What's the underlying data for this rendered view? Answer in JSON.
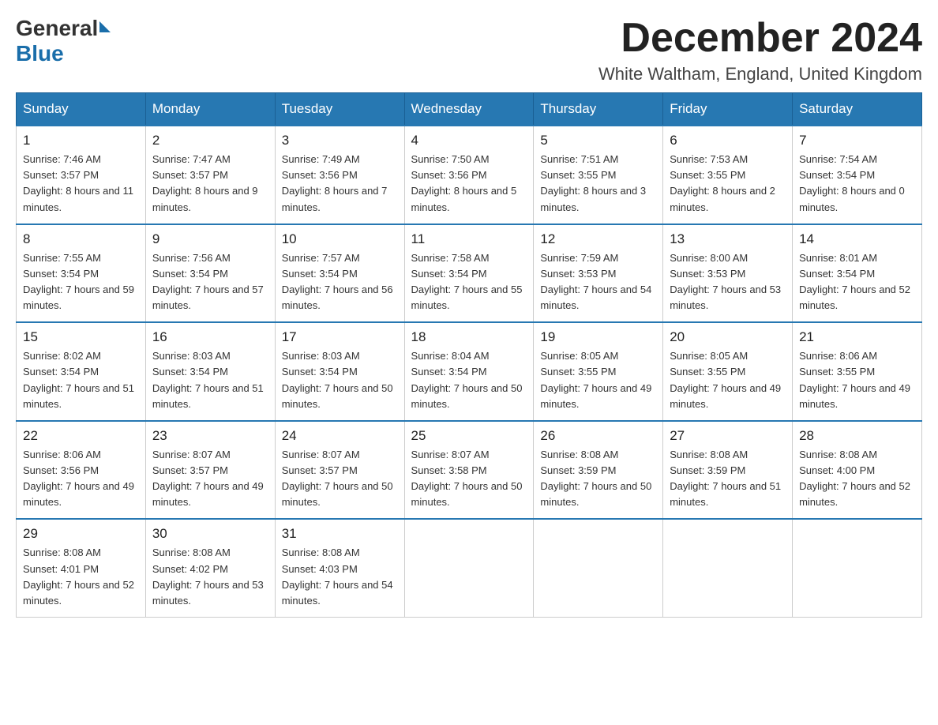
{
  "header": {
    "logo_general": "General",
    "logo_blue": "Blue",
    "month_title": "December 2024",
    "location": "White Waltham, England, United Kingdom"
  },
  "weekdays": [
    "Sunday",
    "Monday",
    "Tuesday",
    "Wednesday",
    "Thursday",
    "Friday",
    "Saturday"
  ],
  "weeks": [
    [
      {
        "day": "1",
        "sunrise": "7:46 AM",
        "sunset": "3:57 PM",
        "daylight": "8 hours and 11 minutes."
      },
      {
        "day": "2",
        "sunrise": "7:47 AM",
        "sunset": "3:57 PM",
        "daylight": "8 hours and 9 minutes."
      },
      {
        "day": "3",
        "sunrise": "7:49 AM",
        "sunset": "3:56 PM",
        "daylight": "8 hours and 7 minutes."
      },
      {
        "day": "4",
        "sunrise": "7:50 AM",
        "sunset": "3:56 PM",
        "daylight": "8 hours and 5 minutes."
      },
      {
        "day": "5",
        "sunrise": "7:51 AM",
        "sunset": "3:55 PM",
        "daylight": "8 hours and 3 minutes."
      },
      {
        "day": "6",
        "sunrise": "7:53 AM",
        "sunset": "3:55 PM",
        "daylight": "8 hours and 2 minutes."
      },
      {
        "day": "7",
        "sunrise": "7:54 AM",
        "sunset": "3:54 PM",
        "daylight": "8 hours and 0 minutes."
      }
    ],
    [
      {
        "day": "8",
        "sunrise": "7:55 AM",
        "sunset": "3:54 PM",
        "daylight": "7 hours and 59 minutes."
      },
      {
        "day": "9",
        "sunrise": "7:56 AM",
        "sunset": "3:54 PM",
        "daylight": "7 hours and 57 minutes."
      },
      {
        "day": "10",
        "sunrise": "7:57 AM",
        "sunset": "3:54 PM",
        "daylight": "7 hours and 56 minutes."
      },
      {
        "day": "11",
        "sunrise": "7:58 AM",
        "sunset": "3:54 PM",
        "daylight": "7 hours and 55 minutes."
      },
      {
        "day": "12",
        "sunrise": "7:59 AM",
        "sunset": "3:53 PM",
        "daylight": "7 hours and 54 minutes."
      },
      {
        "day": "13",
        "sunrise": "8:00 AM",
        "sunset": "3:53 PM",
        "daylight": "7 hours and 53 minutes."
      },
      {
        "day": "14",
        "sunrise": "8:01 AM",
        "sunset": "3:54 PM",
        "daylight": "7 hours and 52 minutes."
      }
    ],
    [
      {
        "day": "15",
        "sunrise": "8:02 AM",
        "sunset": "3:54 PM",
        "daylight": "7 hours and 51 minutes."
      },
      {
        "day": "16",
        "sunrise": "8:03 AM",
        "sunset": "3:54 PM",
        "daylight": "7 hours and 51 minutes."
      },
      {
        "day": "17",
        "sunrise": "8:03 AM",
        "sunset": "3:54 PM",
        "daylight": "7 hours and 50 minutes."
      },
      {
        "day": "18",
        "sunrise": "8:04 AM",
        "sunset": "3:54 PM",
        "daylight": "7 hours and 50 minutes."
      },
      {
        "day": "19",
        "sunrise": "8:05 AM",
        "sunset": "3:55 PM",
        "daylight": "7 hours and 49 minutes."
      },
      {
        "day": "20",
        "sunrise": "8:05 AM",
        "sunset": "3:55 PM",
        "daylight": "7 hours and 49 minutes."
      },
      {
        "day": "21",
        "sunrise": "8:06 AM",
        "sunset": "3:55 PM",
        "daylight": "7 hours and 49 minutes."
      }
    ],
    [
      {
        "day": "22",
        "sunrise": "8:06 AM",
        "sunset": "3:56 PM",
        "daylight": "7 hours and 49 minutes."
      },
      {
        "day": "23",
        "sunrise": "8:07 AM",
        "sunset": "3:57 PM",
        "daylight": "7 hours and 49 minutes."
      },
      {
        "day": "24",
        "sunrise": "8:07 AM",
        "sunset": "3:57 PM",
        "daylight": "7 hours and 50 minutes."
      },
      {
        "day": "25",
        "sunrise": "8:07 AM",
        "sunset": "3:58 PM",
        "daylight": "7 hours and 50 minutes."
      },
      {
        "day": "26",
        "sunrise": "8:08 AM",
        "sunset": "3:59 PM",
        "daylight": "7 hours and 50 minutes."
      },
      {
        "day": "27",
        "sunrise": "8:08 AM",
        "sunset": "3:59 PM",
        "daylight": "7 hours and 51 minutes."
      },
      {
        "day": "28",
        "sunrise": "8:08 AM",
        "sunset": "4:00 PM",
        "daylight": "7 hours and 52 minutes."
      }
    ],
    [
      {
        "day": "29",
        "sunrise": "8:08 AM",
        "sunset": "4:01 PM",
        "daylight": "7 hours and 52 minutes."
      },
      {
        "day": "30",
        "sunrise": "8:08 AM",
        "sunset": "4:02 PM",
        "daylight": "7 hours and 53 minutes."
      },
      {
        "day": "31",
        "sunrise": "8:08 AM",
        "sunset": "4:03 PM",
        "daylight": "7 hours and 54 minutes."
      },
      null,
      null,
      null,
      null
    ]
  ]
}
